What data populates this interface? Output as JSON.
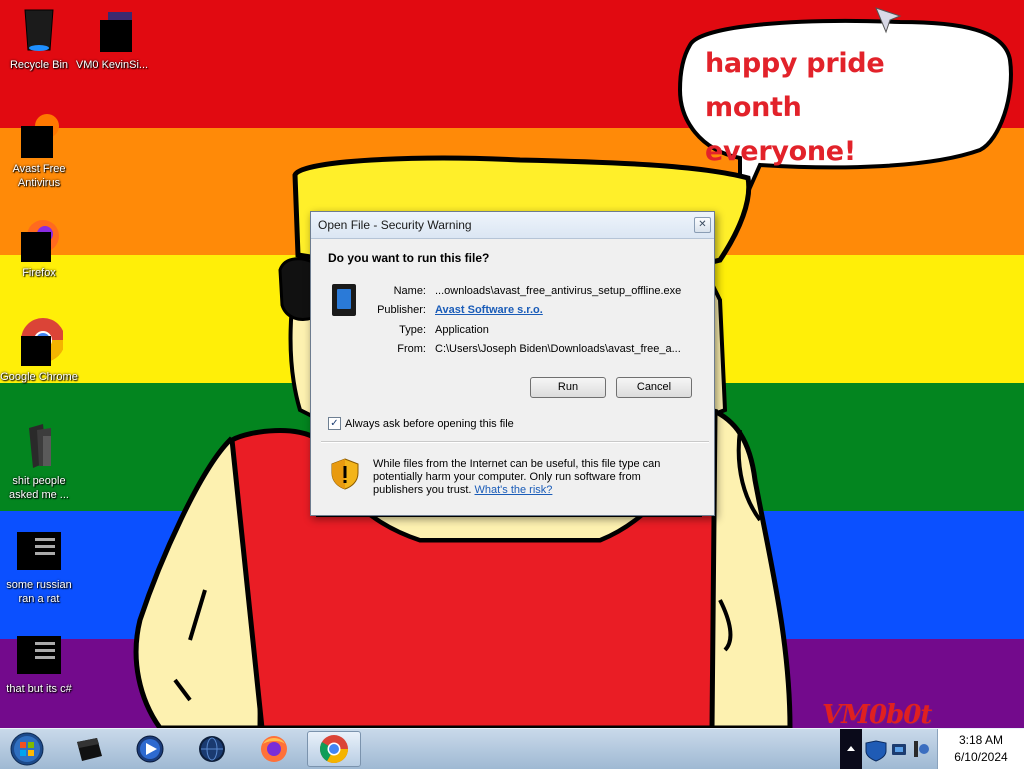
{
  "desktop_icons": [
    {
      "label": "Recycle Bin",
      "icon": "recycle-bin-icon"
    },
    {
      "label": "VM0 KevinSi...",
      "icon": "vm-icon"
    },
    {
      "label": "Avast Free Antivirus",
      "icon": "avast-icon"
    },
    {
      "label": "Firefox",
      "icon": "firefox-icon"
    },
    {
      "label": "Google Chrome",
      "icon": "chrome-icon"
    },
    {
      "label": "shit people asked me ...",
      "icon": "folder-icon"
    },
    {
      "label": "some russian ran a rat",
      "icon": "app-window-icon"
    },
    {
      "label": "that but its c#",
      "icon": "app-window-icon"
    }
  ],
  "wallpaper": {
    "speech_bubble": [
      "happy pride month",
      "everyone!"
    ],
    "signature": "VM0b0t",
    "colors": {
      "red": "#e10a11",
      "orange": "#ff8a08",
      "yellow": "#ffef08",
      "green": "#03851f",
      "blue": "#0b50ff",
      "purple": "#730a8c"
    }
  },
  "dialog": {
    "title": "Open File - Security Warning",
    "question": "Do you want to run this file?",
    "fields": {
      "name_label": "Name:",
      "name_value": "...ownloads\\avast_free_antivirus_setup_offline.exe",
      "publisher_label": "Publisher:",
      "publisher_value": "Avast Software s.r.o.",
      "type_label": "Type:",
      "type_value": "Application",
      "from_label": "From:",
      "from_value": "C:\\Users\\Joseph Biden\\Downloads\\avast_free_a..."
    },
    "run_button": "Run",
    "cancel_button": "Cancel",
    "checkbox_label": "Always ask before opening this file",
    "checkbox_checked": true,
    "warning_text": "While files from the Internet can be useful, this file type can potentially harm your computer. Only run software from publishers you trust.",
    "warning_link": "What's the risk?"
  },
  "taskbar": {
    "items": [
      "virtualbox-icon",
      "media-player-icon",
      "globe-icon",
      "firefox-icon",
      "chrome-icon"
    ],
    "active_item": "chrome-icon",
    "clock_time": "3:18 AM",
    "clock_date": "6/10/2024"
  }
}
